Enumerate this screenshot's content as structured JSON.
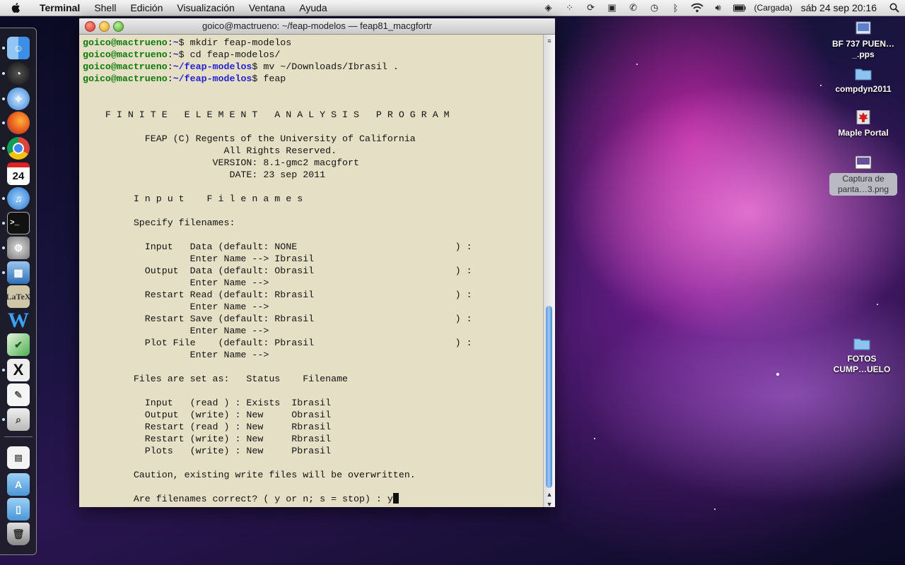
{
  "menubar": {
    "app": "Terminal",
    "menus": [
      "Shell",
      "Edición",
      "Visualización",
      "Ventana",
      "Ayuda"
    ],
    "battery_status": "(Cargada)",
    "clock": "sáb 24 sep  20:16"
  },
  "window": {
    "title": "goico@mactrueno: ~/feap-modelos — feap81_macgfortr"
  },
  "terminal": {
    "prompts": [
      {
        "user": "goico@mactrueno",
        "path": "~",
        "cmd": "$ mkdir feap-modelos"
      },
      {
        "user": "goico@mactrueno",
        "path": "~",
        "cmd": "$ cd feap-modelos/"
      },
      {
        "user": "goico@mactrueno",
        "path": "~/feap-modelos",
        "cmd": "$ mv ~/Downloads/Ibrasil ."
      },
      {
        "user": "goico@mactrueno",
        "path": "~/feap-modelos",
        "cmd": "$ feap"
      }
    ],
    "output_lines": [
      "",
      "",
      "    F I N I T E   E L E M E N T   A N A L Y S I S   P R O G R A M",
      "",
      "           FEAP (C) Regents of the University of California",
      "                         All Rights Reserved.",
      "                       VERSION: 8.1-gmc2 macgfort",
      "                          DATE: 23 sep 2011",
      "",
      "         I n p u t    F i l e n a m e s",
      "",
      "         Specify filenames:",
      "",
      "           Input   Data (default: NONE                            ) :",
      "                   Enter Name --> Ibrasil",
      "           Output  Data (default: Obrasil                         ) :",
      "                   Enter Name -->",
      "           Restart Read (default: Rbrasil                         ) :",
      "                   Enter Name -->",
      "           Restart Save (default: Rbrasil                         ) :",
      "                   Enter Name -->",
      "           Plot File    (default: Pbrasil                         ) :",
      "                   Enter Name -->",
      "",
      "         Files are set as:   Status    Filename",
      "",
      "           Input   (read ) : Exists  Ibrasil",
      "           Output  (write) : New     Obrasil",
      "           Restart (read ) : New     Rbrasil",
      "           Restart (write) : New     Rbrasil",
      "           Plots   (write) : New     Pbrasil",
      "",
      "         Caution, existing write files will be overwritten.",
      "",
      "         Are filenames correct? ( y or n; s = stop) : y"
    ]
  },
  "desktop_icons": [
    {
      "label": "BF 737 PUEN…_.pps",
      "icon": "document-icon"
    },
    {
      "label": "compdyn2011",
      "icon": "folder-icon"
    },
    {
      "label": "Maple Portal",
      "icon": "maple-icon"
    },
    {
      "label": "Captura de panta…3.png",
      "icon": "image-icon"
    },
    {
      "label": "FOTOS CUMP…UELO",
      "icon": "folder-icon"
    }
  ],
  "dock_items": [
    "finder",
    "dashboard",
    "safari",
    "firefox",
    "chrome",
    "ical",
    "itunes",
    "terminal",
    "system-preferences",
    "virtualbox",
    "latex",
    "word",
    "gedit",
    "x11",
    "textedit",
    "preview",
    "documents",
    "applications",
    "downloads",
    "trash"
  ],
  "colors": {
    "terminal_bg": "#e5e0c5",
    "user": "#0a7a0a",
    "path": "#2222d0"
  }
}
